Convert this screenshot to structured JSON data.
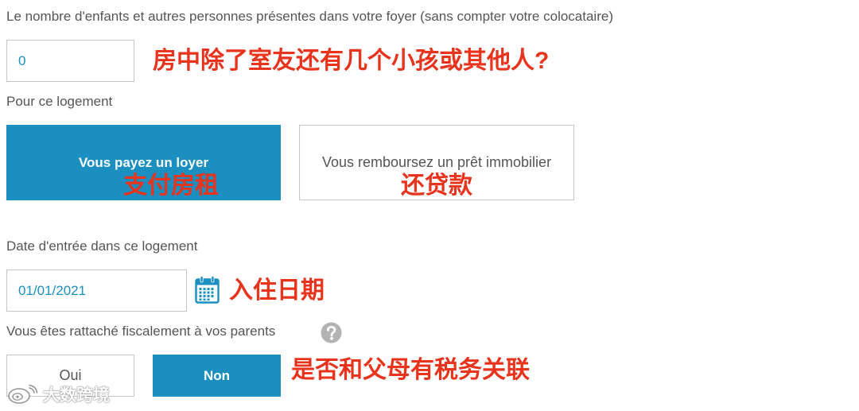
{
  "colors": {
    "accent": "#1a8fc0",
    "annotation": "#e8331d",
    "label_text": "#555555",
    "border": "#c4c4c4",
    "help_icon": "#b3b3b3"
  },
  "form": {
    "household": {
      "label": "Le nombre d'enfants et autres personnes présentes dans votre foyer (sans compter votre colocataire)",
      "value": "0"
    },
    "housing": {
      "label": "Pour ce logement",
      "options": [
        {
          "label": "Vous payez un loyer",
          "selected": true
        },
        {
          "label": "Vous remboursez un prêt immobilier",
          "selected": false
        }
      ]
    },
    "move_in_date": {
      "label": "Date d'entrée dans ce logement",
      "value": "01/01/2021",
      "icon": "calendar-icon"
    },
    "tax_attachment": {
      "label": "Vous êtes rattaché fiscalement à vos parents",
      "help_icon": "help-icon",
      "options": [
        {
          "label": "Oui",
          "selected": false
        },
        {
          "label": "Non",
          "selected": true
        }
      ]
    }
  },
  "annotations": {
    "household": "房中除了室友还有几个小孩或其他人?",
    "rent": "支付房租",
    "loan": "还贷款",
    "move_in_date": "入住日期",
    "tax_attachment": "是否和父母有税务关联"
  },
  "watermark": {
    "text": "大数跨境",
    "icon": "watermark-logo-icon"
  }
}
